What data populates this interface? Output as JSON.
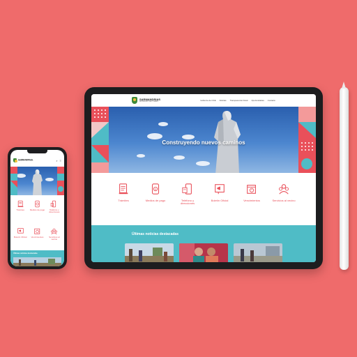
{
  "site": {
    "logo_name": "SARMANDRIAS",
    "logo_sub": "MUNICIPIO DE YORES"
  },
  "nav": [
    "Gobierno de OCE",
    "Noticias",
    "Transparencia Fiscal",
    "Oportunidades",
    "Contacto"
  ],
  "hero": {
    "title": "Construyendo nuevos caminos"
  },
  "services": [
    {
      "label": "Trámites",
      "icon": "document-stamp-icon"
    },
    {
      "label": "Medios de pago",
      "icon": "payment-icon"
    },
    {
      "label": "Teléfono y direcciones",
      "icon": "phone-icon"
    },
    {
      "label": "Boletín Oficial",
      "icon": "megaphone-icon"
    },
    {
      "label": "Vencimientos",
      "icon": "calendar-clock-icon"
    },
    {
      "label": "Servicios al vecino",
      "icon": "people-icon"
    }
  ],
  "news": {
    "title": "Últimas noticias destacadas"
  },
  "colors": {
    "background": "#ef6b6b",
    "accent": "#e9505a",
    "teal": "#4fbcc6"
  }
}
